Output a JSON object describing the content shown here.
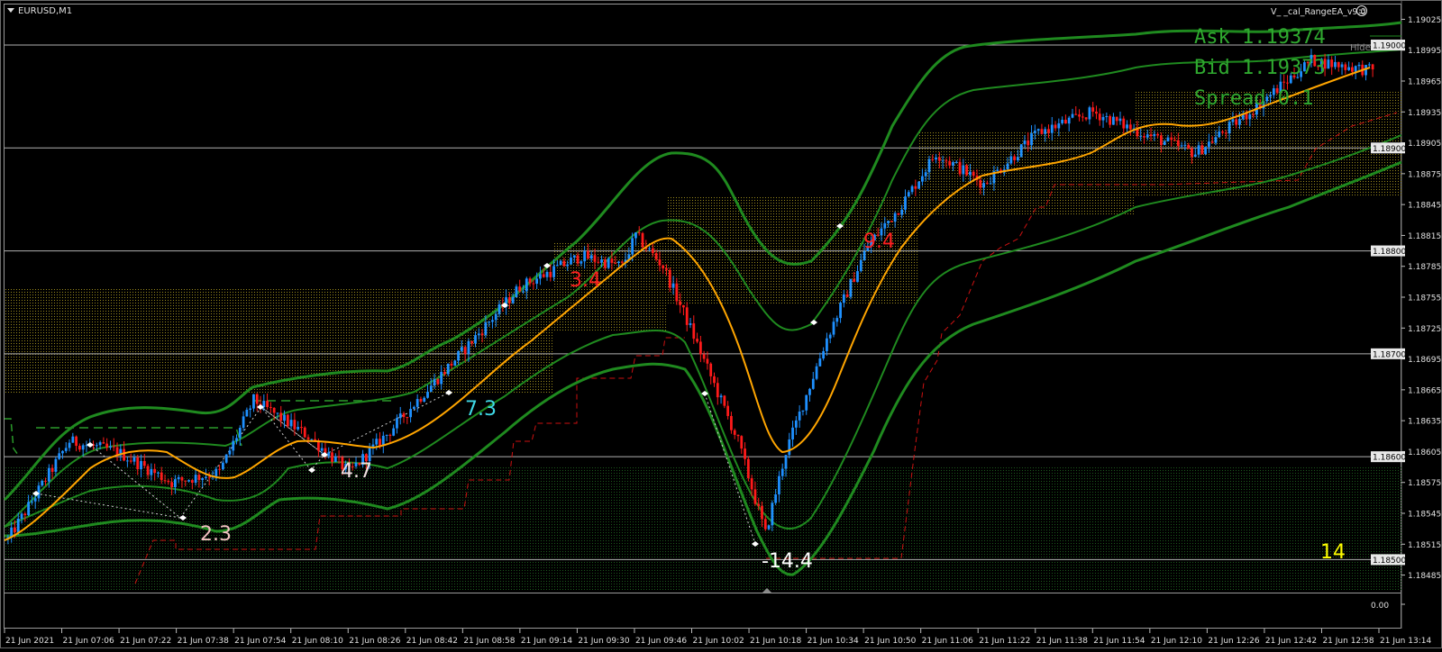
{
  "window": {
    "symbol_label": "EURUSD,M1",
    "ea_label": "V_ _cal_RangeEA_v9.0",
    "hide_label": "Hide"
  },
  "info": {
    "ask": "Ask 1.19374",
    "bid": "Bid 1.19373",
    "spread": "Spread 0.1"
  },
  "annotations": [
    {
      "text": "2.3",
      "color": "#f1c0c0"
    },
    {
      "text": "4.7",
      "color": "#f1e0e0"
    },
    {
      "text": "7.3",
      "color": "#3fd8e6"
    },
    {
      "text": "3.4",
      "color": "#ff2020"
    },
    {
      "text": "-14.4",
      "color": "#ffffff"
    },
    {
      "text": "9.4",
      "color": "#ff2020"
    },
    {
      "text": "14",
      "color": "#ffff00"
    }
  ],
  "price_axis": {
    "ticks": [
      "1.19025",
      "1.18995",
      "1.18965",
      "1.18935",
      "1.18905",
      "1.18875",
      "1.18845",
      "1.18815",
      "1.18785",
      "1.18755",
      "1.18725",
      "1.18695",
      "1.18665",
      "1.18635",
      "1.18605",
      "1.18575",
      "1.18545",
      "1.18515",
      "1.18485"
    ],
    "boxed": [
      "1.19000",
      "1.18900",
      "1.18800",
      "1.18700",
      "1.18600",
      "1.18500"
    ]
  },
  "indicator_axis": {
    "ticks": [
      "0.00"
    ]
  },
  "time_axis": {
    "ticks": [
      "21 Jun 2021",
      "21 Jun 07:06",
      "21 Jun 07:22",
      "21 Jun 07:38",
      "21 Jun 07:54",
      "21 Jun 08:10",
      "21 Jun 08:26",
      "21 Jun 08:42",
      "21 Jun 08:58",
      "21 Jun 09:14",
      "21 Jun 09:30",
      "21 Jun 09:46",
      "21 Jun 10:02",
      "21 Jun 10:18",
      "21 Jun 10:34",
      "21 Jun 10:50",
      "21 Jun 11:06",
      "21 Jun 11:22",
      "21 Jun 11:38",
      "21 Jun 11:54",
      "21 Jun 12:10",
      "21 Jun 12:26",
      "21 Jun 12:42",
      "21 Jun 12:58",
      "21 Jun 13:14"
    ]
  },
  "chart_data": {
    "type": "candlestick",
    "symbol": "EURUSD",
    "timeframe": "M1",
    "ylim": [
      1.18475,
      1.19035
    ],
    "horizontal_levels": [
      1.19,
      1.189,
      1.188,
      1.187,
      1.186,
      1.185
    ],
    "trend_anchors": [
      [
        0,
        1.1852
      ],
      [
        18,
        1.18615
      ],
      [
        32,
        1.18605
      ],
      [
        48,
        1.18575
      ],
      [
        62,
        1.18585
      ],
      [
        72,
        1.18655
      ],
      [
        88,
        1.1862
      ],
      [
        100,
        1.18585
      ],
      [
        112,
        1.18625
      ],
      [
        120,
        1.18655
      ],
      [
        134,
        1.18705
      ],
      [
        150,
        1.18765
      ],
      [
        168,
        1.18795
      ],
      [
        180,
        1.18785
      ],
      [
        184,
        1.18815
      ],
      [
        192,
        1.18785
      ],
      [
        200,
        1.18725
      ],
      [
        214,
        1.18615
      ],
      [
        222,
        1.18525
      ],
      [
        228,
        1.18605
      ],
      [
        240,
        1.18715
      ],
      [
        252,
        1.18805
      ],
      [
        262,
        1.18845
      ],
      [
        272,
        1.18895
      ],
      [
        286,
        1.18865
      ],
      [
        302,
        1.18915
      ],
      [
        318,
        1.18935
      ],
      [
        332,
        1.18915
      ],
      [
        348,
        1.18895
      ],
      [
        364,
        1.18935
      ],
      [
        382,
        1.18985
      ],
      [
        400,
        1.18975
      ]
    ],
    "colors": {
      "bull": "#1e90ff",
      "bear": "#ff1a1a",
      "ma": "#ffa500",
      "envelope": "#1f8a1f",
      "zone": "#8a8a2a"
    }
  }
}
